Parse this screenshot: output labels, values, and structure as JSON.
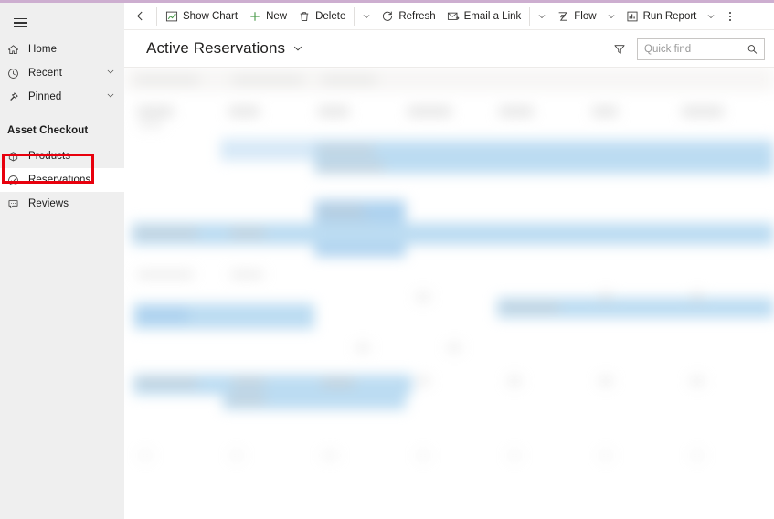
{
  "theme": {
    "accent_bar_color": "#cdaed0",
    "sidebar_background": "#efefef",
    "highlight_box_color": "#e8000d",
    "new_icon_color": "#4a9b4a",
    "selection_blue": "#bcdcf2"
  },
  "sidebar": {
    "menu_button": "menu",
    "items": [
      {
        "label": "Home",
        "icon": "home-icon",
        "has_chevron": false,
        "selected": false
      },
      {
        "label": "Recent",
        "icon": "clock-icon",
        "has_chevron": true,
        "selected": false
      },
      {
        "label": "Pinned",
        "icon": "pin-icon",
        "has_chevron": true,
        "selected": false
      }
    ],
    "section_title": "Asset Checkout",
    "section_items": [
      {
        "label": "Products",
        "icon": "box-icon",
        "selected": false
      },
      {
        "label": "Reservations",
        "icon": "check-circle-icon",
        "selected": true
      },
      {
        "label": "Reviews",
        "icon": "comment-icon",
        "selected": false
      }
    ]
  },
  "command_bar": {
    "back_label": "Back",
    "buttons": [
      {
        "label": "Show Chart",
        "icon": "chart-icon",
        "caret": false
      },
      {
        "label": "New",
        "icon": "plus-icon",
        "caret": false
      },
      {
        "label": "Delete",
        "icon": "trash-icon",
        "caret": true
      },
      {
        "label": "Refresh",
        "icon": "refresh-icon",
        "caret": false
      },
      {
        "label": "Email a Link",
        "icon": "email-icon",
        "caret": true
      },
      {
        "label": "Flow",
        "icon": "flow-icon",
        "caret": true
      },
      {
        "label": "Run Report",
        "icon": "report-icon",
        "caret": true
      }
    ],
    "overflow_label": "More commands"
  },
  "view_header": {
    "title": "Active Reservations",
    "title_caret": "chevron-down-icon",
    "filter_label": "Filter",
    "search": {
      "placeholder": "Quick find",
      "value": "",
      "icon": "search-icon"
    }
  },
  "grid": {
    "state": "blurred",
    "description": "Reservation records grid with blurred/redacted content and several highlighted rows"
  }
}
